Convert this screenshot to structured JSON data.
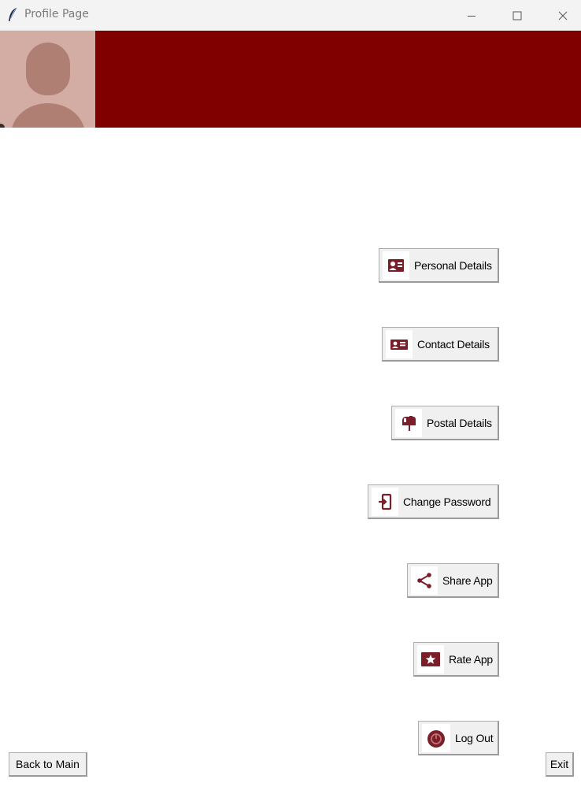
{
  "window": {
    "title": "Profile Page",
    "app_icon": "feather-icon"
  },
  "header": {
    "accent_color": "#800000",
    "avatar": "user-silhouette-icon"
  },
  "menu": [
    {
      "label": "Personal Details",
      "icon": "id-card-icon"
    },
    {
      "label": "Contact Details",
      "icon": "contact-card-icon"
    },
    {
      "label": "Postal Details",
      "icon": "mailbox-icon"
    },
    {
      "label": "Change Password",
      "icon": "login-door-icon"
    },
    {
      "label": "Share App",
      "icon": "share-icon"
    },
    {
      "label": "Rate App",
      "icon": "star-badge-icon"
    },
    {
      "label": "Log Out",
      "icon": "power-icon"
    }
  ],
  "footer": {
    "back_label": "Back to Main",
    "exit_label": "Exit"
  }
}
